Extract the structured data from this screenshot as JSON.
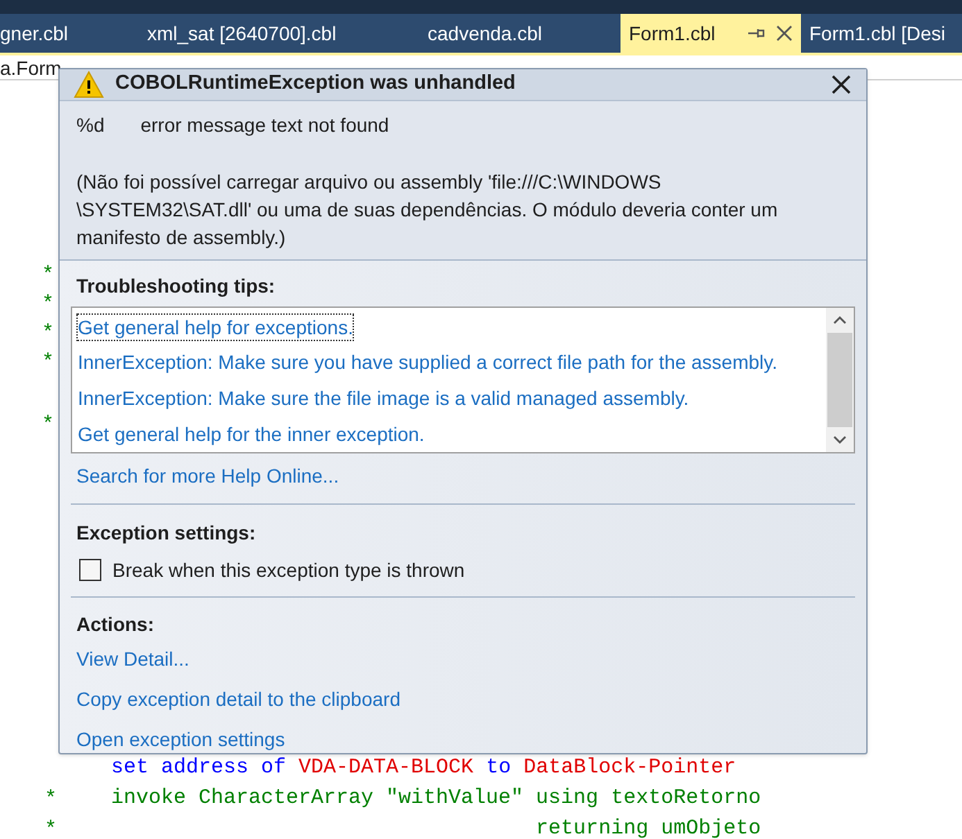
{
  "tabs": [
    {
      "label": "gner.cbl",
      "selected": false
    },
    {
      "label": "xml_sat [2640700].cbl",
      "selected": false
    },
    {
      "label": "cadvenda.cbl",
      "selected": false
    },
    {
      "label": "Form1.cbl",
      "selected": true
    },
    {
      "label": "Form1.cbl [Desi",
      "selected": false
    }
  ],
  "breadcrumb": "a.Form",
  "gutter_lines": [
    {
      "marker": "*"
    },
    {
      "marker": "*"
    },
    {
      "marker": "*"
    },
    {
      "marker": "*"
    },
    {
      "marker": "*"
    }
  ],
  "editor_lines": [
    {
      "tokens": [
        {
          "text": "    set address of ",
          "kind": "keyword"
        },
        {
          "text": "VDA-DATA-BLOCK",
          "kind": "identifier"
        },
        {
          "text": " to ",
          "kind": "keyword"
        },
        {
          "text": "DataBlock-Pointer",
          "kind": "identifier"
        }
      ]
    },
    {
      "marker": "*",
      "tokens": [
        {
          "text": "    invoke CharacterArray \"withValue\" using textoRetorno",
          "kind": "comment"
        }
      ]
    },
    {
      "marker": "*",
      "tokens": [
        {
          "text": "                                      returning umObjeto",
          "kind": "comment"
        }
      ]
    }
  ],
  "dialog": {
    "title": "COBOLRuntimeException was unhandled",
    "code": "%d",
    "message": "error message text not found",
    "detail": "(Não foi possível carregar arquivo ou assembly 'file:///C:\\WINDOWS \\SYSTEM32\\SAT.dll' ou uma de suas dependências. O módulo deveria conter um manifesto de assembly.)",
    "tips_heading": "Troubleshooting tips:",
    "tips": [
      {
        "label": "Get general help for exceptions.",
        "selected": true
      },
      {
        "label": "InnerException: Make sure you have supplied a correct file path for the assembly.",
        "selected": false
      },
      {
        "label": "InnerException: Make sure the file image is a valid managed assembly.",
        "selected": false
      },
      {
        "label": "Get general help for the inner exception.",
        "selected": false
      }
    ],
    "help_link": "Search for more Help Online...",
    "settings_heading": "Exception settings:",
    "break_option": {
      "label": "Break when this exception type is thrown",
      "checked": false
    },
    "actions_heading": "Actions:",
    "actions": [
      "View Detail...",
      "Copy exception detail to the clipboard",
      "Open exception settings"
    ]
  }
}
